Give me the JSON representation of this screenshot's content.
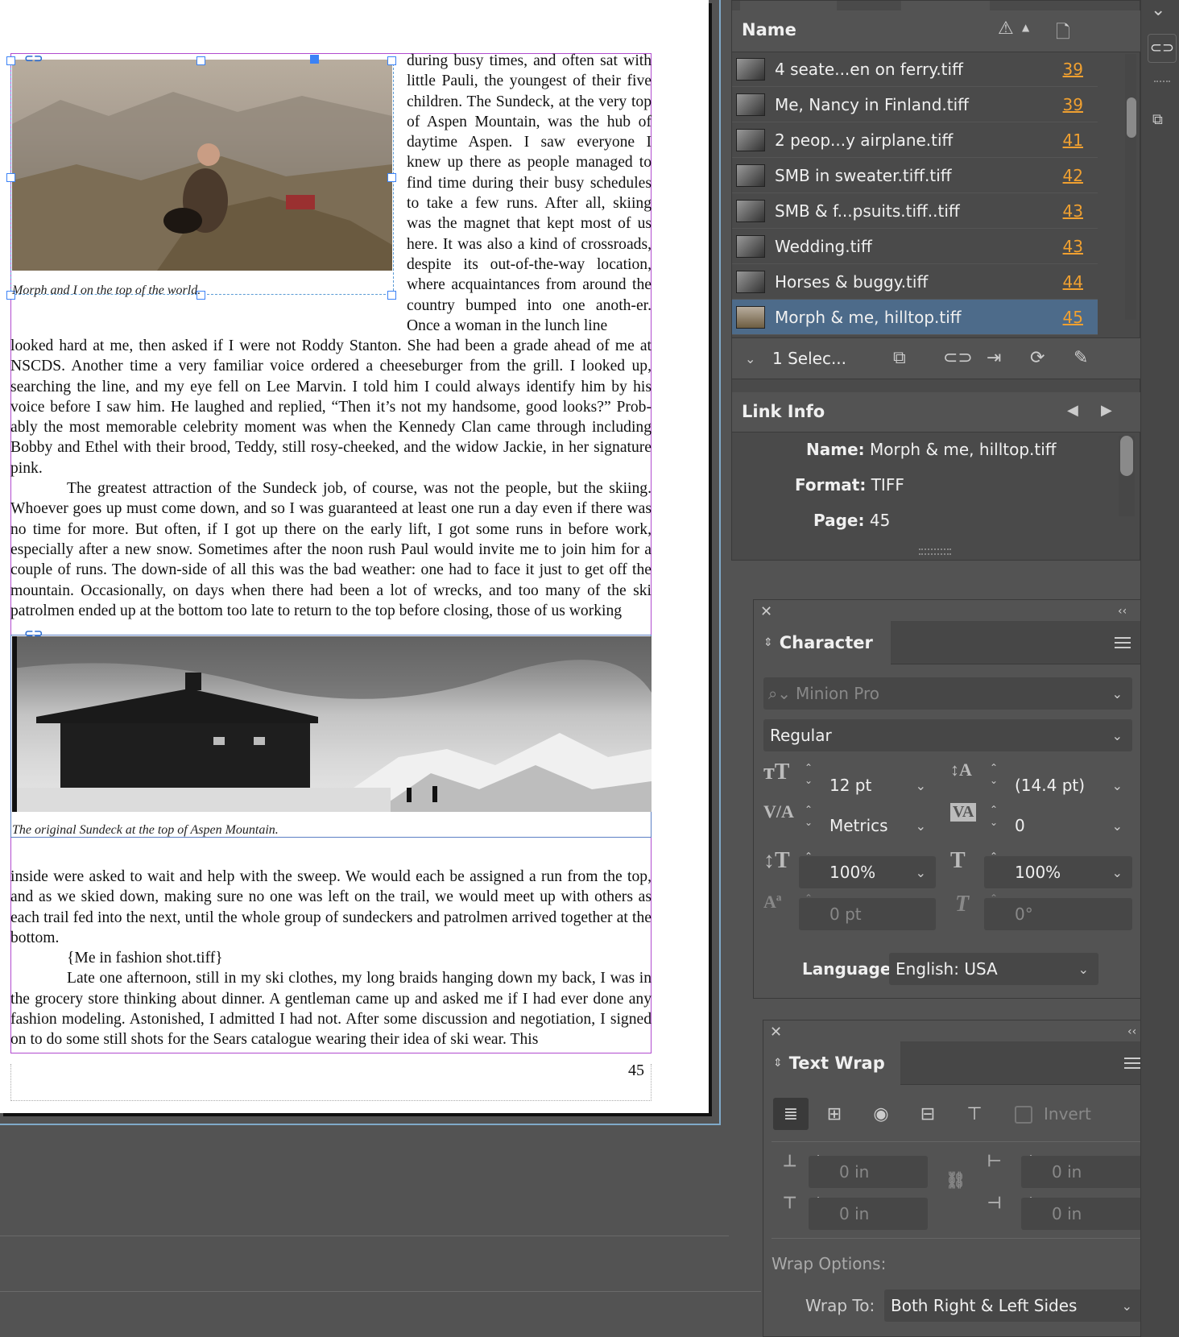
{
  "document": {
    "paragraph_right_column": "during busy times, and often sat with little Pauli, the youngest of their five children. The Sundeck, at the very top of Aspen Mountain, was the hub of daytime Aspen. I saw everyone I knew up there as people managed to find time during their busy schedules to take a few runs. After all, skiing was the magnet that kept most of us here. It was also a kind of crossroads, despite its out-of-the-way location, where acquaintances from around the country bumped into one anoth-er. Once a woman in the lunch line",
    "paragraph_full_1": "looked hard at me, then asked if I were not Roddy Stanton. She had been a grade ahead of me at NSCDS. Another time a very familiar voice ordered a cheeseburger from the grill. I looked up, searching the line, and my eye fell on Lee Marvin. I told him I could always identify him by his voice before I saw him. He laughed and replied, “Then it’s not my handsome, good looks?” Prob-ably the most memorable celebrity moment was when the Kennedy Clan came through including Bobby and Ethel with their brood, Teddy, still rosy-cheeked, and the widow Jackie, in her signature pink.",
    "paragraph_full_2": "The greatest attraction of the Sundeck job, of course, was not the people, but the skiing. Whoever goes up must come down, and so I was guaranteed at least one run a day even if there was no time for more. But often, if I got up there on the early lift, I got some runs in before work, especially after a new snow. Sometimes after the noon rush Paul would invite me to join him for a couple of runs. The down-side of all this was the bad weather: one had to face it just to get off the mountain. Occasionally, on days when there had been a lot of wrecks, and too many of the ski patrolmen ended up at the bottom too late to return to the top before closing, those of us working",
    "paragraph_full_3": "inside were asked to wait and help with the sweep. We would each be assigned a run from the top, and as we skied down, making sure no one was left on the trail, we would meet up with others as each trail fed into the next, until the whole group of sundeckers and patrolmen arrived together at the bottom.",
    "placeholder_line": "{Me in fashion shot.tiff}",
    "paragraph_full_4": "Late one afternoon, still in my ski clothes, my long braids hanging down my back, I was in the grocery store thinking about dinner. A gentleman came up and asked me if I had ever done any fashion modeling. Astonished, I admitted I had not. After some discussion and negotiation, I signed on to do some still shots for the Sears catalogue wearing their idea of ski wear. This",
    "caption_1": "Morph and I on the top of the world.",
    "caption_2": "The original Sundeck at the top of Aspen Mountain.",
    "page_number": "45"
  },
  "links_panel": {
    "column_name": "Name",
    "rows": [
      {
        "name": "4 seate...en on ferry.tiff",
        "page": "39"
      },
      {
        "name": "Me, Nancy in Finland.tiff",
        "page": "39"
      },
      {
        "name": "2  peop...y airplane.tiff",
        "page": "41"
      },
      {
        "name": "SMB in sweater.tiff.tiff",
        "page": "42"
      },
      {
        "name": "SMB & f...psuits.tiff..tiff",
        "page": "43"
      },
      {
        "name": "Wedding.tiff",
        "page": "43"
      },
      {
        "name": "Horses & buggy.tiff",
        "page": "44"
      },
      {
        "name": "Morph & me, hilltop.tiff",
        "page": "45"
      }
    ],
    "selection_count": "1 Selec...",
    "link_info_title": "Link Info",
    "info": {
      "name_label": "Name:",
      "name_value": "Morph & me, hilltop.tiff",
      "format_label": "Format:",
      "format_value": "TIFF",
      "page_label": "Page:",
      "page_value": "45"
    }
  },
  "character_panel": {
    "title": "Character",
    "font_family": "Minion Pro",
    "font_style": "Regular",
    "font_size": "12 pt",
    "leading": "(14.4 pt)",
    "kerning": "Metrics",
    "tracking": "0",
    "vertical_scale": "100%",
    "horizontal_scale": "100%",
    "baseline_shift": "0 pt",
    "skew": "0°",
    "language_label": "Language:",
    "language_value": "English: USA"
  },
  "text_wrap_panel": {
    "title": "Text Wrap",
    "invert_label": "Invert",
    "top_offset": "0 in",
    "bottom_offset": "0 in",
    "left_offset": "0 in",
    "right_offset": "0 in",
    "wrap_options_label": "Wrap Options:",
    "wrap_to_label": "Wrap To:",
    "wrap_to_value": "Both Right & Left Sides"
  },
  "colors": {
    "ui_background": "#535353",
    "selection_blue": "#4d6b8a",
    "page_link_orange": "#f0a030",
    "frame_magenta": "#b14bcf"
  }
}
